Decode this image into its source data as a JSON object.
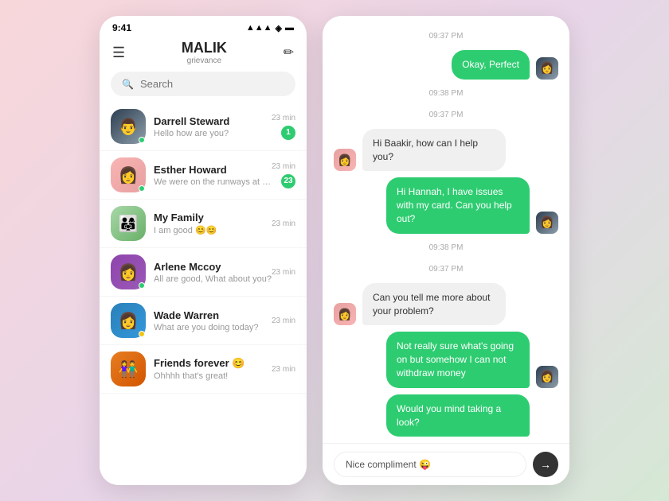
{
  "app": {
    "name": "MALIK",
    "subtitle": "grievance",
    "status_time": "9:41"
  },
  "search": {
    "placeholder": "Search"
  },
  "chats": [
    {
      "id": "darrell",
      "name": "Darrell Steward",
      "preview": "Hello how are you?",
      "time": "23 min",
      "unread": 1,
      "dot": "green",
      "avatar_class": "av-darrell",
      "avatar_emoji": "👨"
    },
    {
      "id": "esther",
      "name": "Esther Howard",
      "preview": "We were on the runways at the...",
      "time": "23 min",
      "unread": 23,
      "dot": "green",
      "avatar_class": "av-esther",
      "avatar_emoji": "👩"
    },
    {
      "id": "family",
      "name": "My Family",
      "preview": "I am good 😊😊",
      "time": "23 min",
      "unread": 0,
      "dot": "none",
      "avatar_class": "av-family",
      "avatar_emoji": "👨‍👩‍👧"
    },
    {
      "id": "arlene",
      "name": "Arlene Mccoy",
      "preview": "All are good, What about you?",
      "time": "23 min",
      "unread": 0,
      "dot": "green",
      "avatar_class": "av-arlene",
      "avatar_emoji": "👩"
    },
    {
      "id": "wade",
      "name": "Wade Warren",
      "preview": "What are you doing today?",
      "time": "23 min",
      "unread": 0,
      "dot": "yellow",
      "avatar_class": "av-wade",
      "avatar_emoji": "👩"
    },
    {
      "id": "friends",
      "name": "Friends forever 😊",
      "preview": "Ohhhh that's great!",
      "time": "23 min",
      "unread": 0,
      "dot": "none",
      "avatar_class": "av-friends",
      "avatar_emoji": "👫"
    }
  ],
  "messages": [
    {
      "id": 1,
      "type": "sent",
      "text": "Okay, Perfect",
      "timestamp": "09:38 PM"
    },
    {
      "id": 2,
      "type": "received",
      "text": "Hi Baakir, how can I help you?",
      "timestamp": "09:37 PM",
      "show_timestamp_above": true
    },
    {
      "id": 3,
      "type": "sent",
      "text": "Hi Hannah, I have issues with my card. Can you help out?",
      "timestamp": "09:38 PM"
    },
    {
      "id": 4,
      "type": "received",
      "text": "Can you tell me more about your problem?",
      "timestamp": "09:37 PM",
      "show_timestamp_above": true
    },
    {
      "id": 5,
      "type": "sent",
      "text": "Not really sure what's going on but somehow I can not withdraw money",
      "timestamp": null
    },
    {
      "id": 6,
      "type": "sent",
      "text": "Would you mind taking a look?",
      "timestamp": "09:38 PM"
    }
  ],
  "input": {
    "placeholder": "Nice compliment 😜",
    "current_value": "Nice compliment 😜"
  },
  "timestamps": {
    "t1": "09:37 PM",
    "t2": "09:38 PM"
  }
}
